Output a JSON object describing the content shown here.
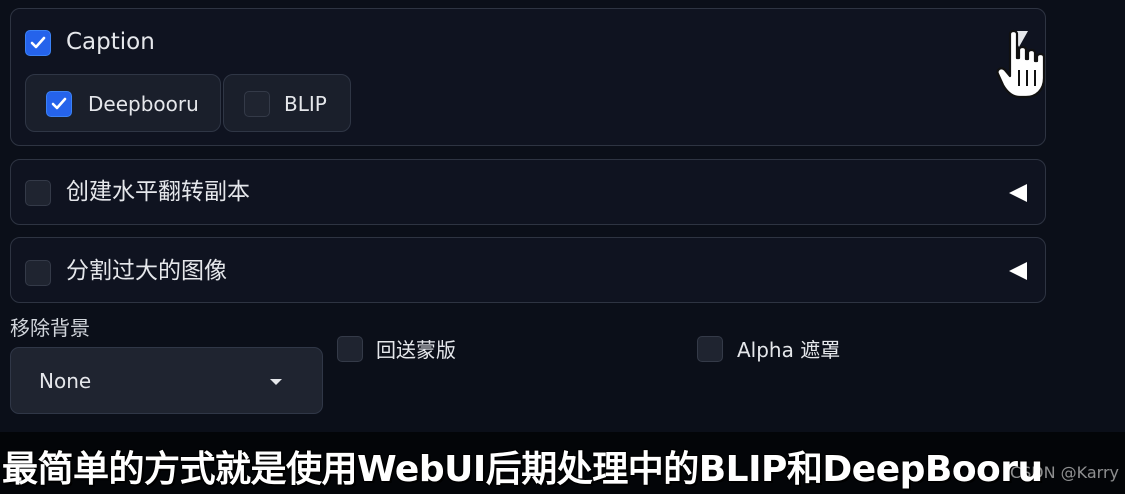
{
  "caption_panel": {
    "label": "Caption",
    "checked": true,
    "options": [
      {
        "label": "Deepbooru",
        "checked": true
      },
      {
        "label": "BLIP",
        "checked": false
      }
    ]
  },
  "flip_panel": {
    "label": "创建水平翻转副本",
    "checked": false
  },
  "split_panel": {
    "label": "分割过大的图像",
    "checked": false
  },
  "remove_background": {
    "label": "移除背景",
    "selected": "None"
  },
  "return_mask": {
    "label": "回送蒙版",
    "checked": false
  },
  "alpha_matting": {
    "label": "Alpha 遮罩",
    "checked": false
  },
  "subtitle": {
    "text": "最简单的方式就是使用WebUI后期处理中的BLIP和DeepBooru"
  },
  "watermark": {
    "text": "CSDN @Karry"
  },
  "colors": {
    "background": "#0b0f19",
    "checkbox_checked": "#2563eb",
    "text": "#e5e7eb"
  },
  "icons": {
    "checkmark": "check-icon",
    "collapse": "triangle-down-icon",
    "expand": "triangle-left-icon",
    "cursor": "hand-pointer-icon",
    "dropdown": "caret-down-icon"
  }
}
